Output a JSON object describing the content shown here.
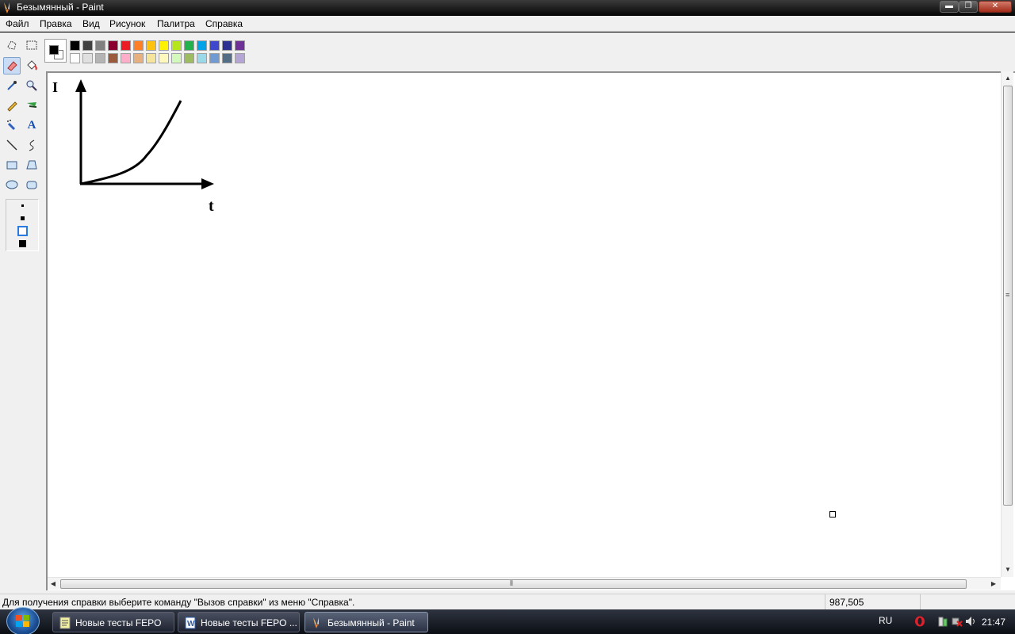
{
  "window": {
    "title": "Безымянный - Paint",
    "buttons": {
      "minimize": "▬",
      "maximize": "❐",
      "close": "✕"
    }
  },
  "menu": [
    "Файл",
    "Правка",
    "Вид",
    "Рисунок",
    "Палитра",
    "Справка"
  ],
  "toolbox": {
    "tools": [
      {
        "name": "free-select",
        "icon": "free-form-select-icon"
      },
      {
        "name": "rect-select",
        "icon": "rectangle-select-icon"
      },
      {
        "name": "eraser",
        "icon": "eraser-icon",
        "selected": true
      },
      {
        "name": "fill",
        "icon": "paint-bucket-icon"
      },
      {
        "name": "picker",
        "icon": "color-picker-icon"
      },
      {
        "name": "magnifier",
        "icon": "magnifier-icon"
      },
      {
        "name": "pencil",
        "icon": "pencil-icon"
      },
      {
        "name": "brush",
        "icon": "brush-icon"
      },
      {
        "name": "airbrush",
        "icon": "airbrush-icon"
      },
      {
        "name": "text",
        "icon": "text-icon",
        "glyph": "A"
      },
      {
        "name": "line",
        "icon": "line-icon"
      },
      {
        "name": "curve",
        "icon": "curve-icon"
      },
      {
        "name": "rectangle",
        "icon": "rectangle-icon"
      },
      {
        "name": "polygon",
        "icon": "polygon-icon"
      },
      {
        "name": "ellipse",
        "icon": "ellipse-icon"
      },
      {
        "name": "rounded-rect",
        "icon": "rounded-rectangle-icon"
      }
    ],
    "selected_size_index": 2
  },
  "palette": {
    "foreground": "#000000",
    "background": "#ffffff",
    "top_row": [
      "#000000",
      "#404040",
      "#808080",
      "#8b0030",
      "#ed1c24",
      "#ff7f27",
      "#ffc20e",
      "#fff200",
      "#b5e61d",
      "#22b14c",
      "#00a2e8",
      "#3f48cc",
      "#2e3192",
      "#6f3198"
    ],
    "bottom_row": [
      "#ffffff",
      "#e0e0e0",
      "#b4b4b4",
      "#9c5a3c",
      "#ffaec9",
      "#e9b07f",
      "#f5e49c",
      "#fff9bd",
      "#d3f9bc",
      "#9dbb61",
      "#99d9ea",
      "#709ad1",
      "#536d87",
      "#b5a5d5"
    ]
  },
  "canvas": {
    "drawing": {
      "y_axis_label": "I",
      "x_axis_label": "t"
    }
  },
  "statusbar": {
    "help_text": "Для получения справки выберите команду \"Вызов справки\" из меню \"Справка\".",
    "coordinates": "987,505"
  },
  "taskbar": {
    "tasks": [
      {
        "label": "Новые тесты FEPO",
        "icon": "notepad-icon",
        "active": false
      },
      {
        "label": "Новые тесты FEPO ...",
        "icon": "word-icon",
        "active": false
      },
      {
        "label": "Безымянный - Paint",
        "icon": "paint-icon",
        "active": true
      }
    ],
    "language": "RU",
    "clock": "21:47",
    "tray_icons": [
      "opera-icon",
      "device-icon",
      "network-icon",
      "volume-icon"
    ]
  }
}
